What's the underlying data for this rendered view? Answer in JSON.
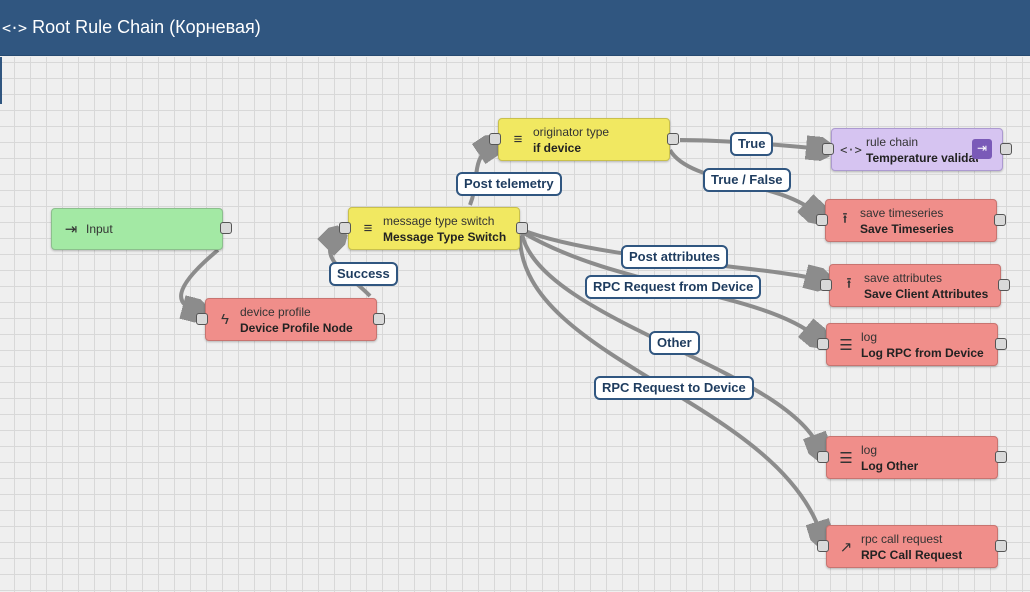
{
  "header": {
    "icon": "code-brackets-icon",
    "icon_glyph": "<·>",
    "title": "Root Rule Chain (Корневая)"
  },
  "nodes": {
    "input": {
      "icon": "login-icon",
      "glyph": "⇥",
      "name": "Input"
    },
    "device_profile": {
      "icon": "bolt-icon",
      "glyph": "ϟ",
      "type": "device profile",
      "name": "Device Profile Node"
    },
    "message_type_switch": {
      "icon": "filter-icon",
      "glyph": "≡",
      "type": "message type switch",
      "name": "Message Type Switch"
    },
    "originator_type": {
      "icon": "filter-icon",
      "glyph": "≡",
      "type": "originator type",
      "name": "if device"
    },
    "rule_chain": {
      "icon": "code-brackets-icon",
      "glyph": "<·>",
      "type": "rule chain",
      "name": "Temperature validat",
      "nav_glyph": "⇥"
    },
    "save_timeseries": {
      "icon": "upload-icon",
      "glyph": "⭱",
      "type": "save timeseries",
      "name": "Save Timeseries"
    },
    "save_attributes": {
      "icon": "upload-icon",
      "glyph": "⭱",
      "type": "save attributes",
      "name": "Save Client Attributes"
    },
    "log_rpc": {
      "icon": "menu-lines-icon",
      "glyph": "☰",
      "type": "log",
      "name": "Log RPC from Device"
    },
    "log_other": {
      "icon": "menu-lines-icon",
      "glyph": "☰",
      "type": "log",
      "name": "Log Other"
    },
    "rpc_call": {
      "icon": "arrow-up-right-icon",
      "glyph": "↗",
      "type": "rpc call request",
      "name": "RPC Call Request"
    }
  },
  "edge_labels": {
    "success": "Success",
    "post_telemetry": "Post telemetry",
    "true": "True",
    "true_false": "True / False",
    "post_attributes": "Post attributes",
    "rpc_from_device": "RPC Request from Device",
    "other": "Other",
    "rpc_to_device": "RPC Request to Device"
  },
  "colors": {
    "header": "#305680",
    "input_node": "#a3e9a4",
    "action_node": "#f08e8a",
    "filter_node": "#f1e861",
    "flow_node": "#d6c4f1",
    "edge": "#8c8c8c"
  }
}
